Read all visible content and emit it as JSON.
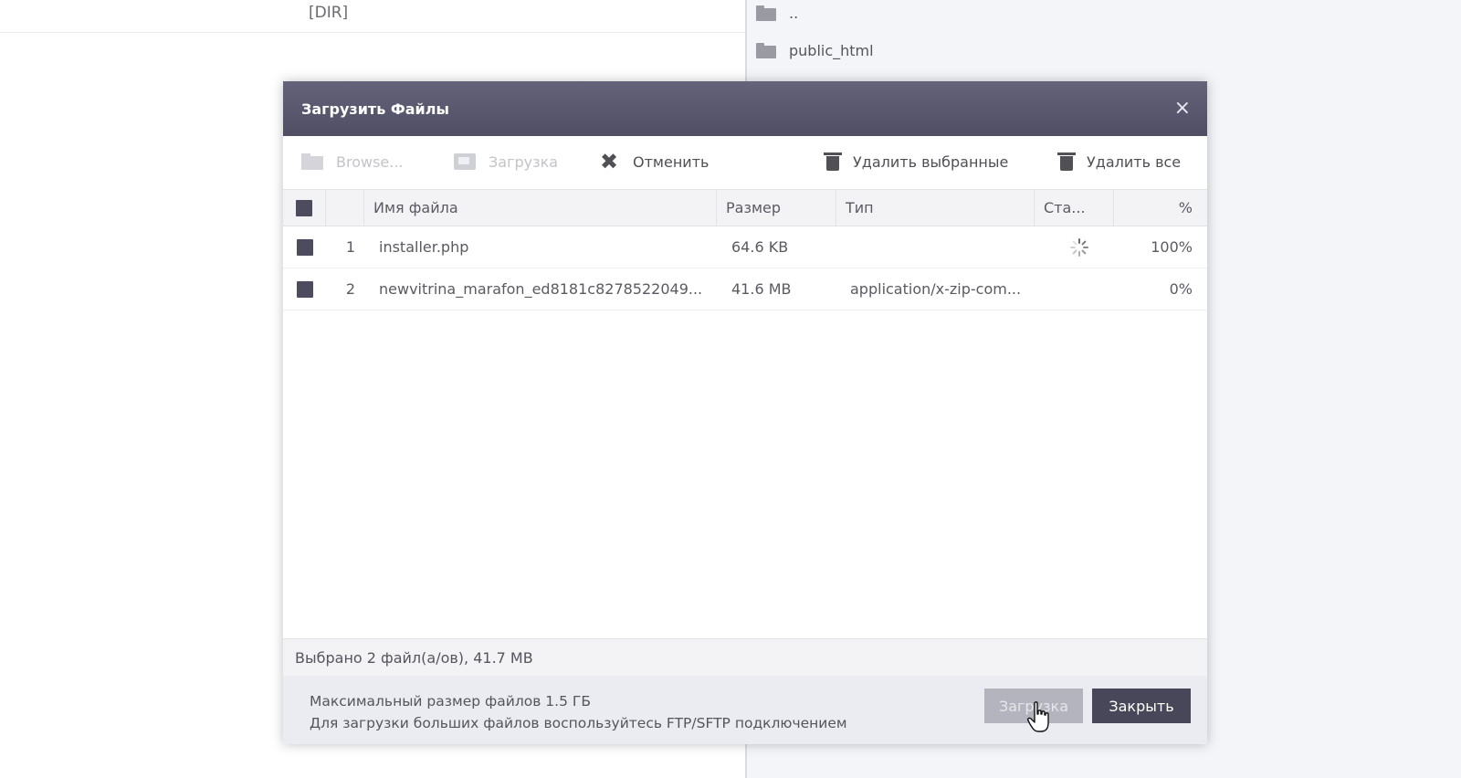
{
  "background": {
    "left_row_label": "[DIR]",
    "right_items": [
      {
        "name": "..",
        "icon": "folder-icon"
      },
      {
        "name": "public_html",
        "icon": "folder-icon"
      }
    ]
  },
  "dialog": {
    "title": "Загрузить Файлы",
    "close_glyph": "×",
    "toolbar": {
      "browse": "Browse...",
      "upload": "Загрузка",
      "cancel": "Отменить",
      "delete_selected": "Удалить выбранные",
      "delete_all": "Удалить все"
    },
    "columns": {
      "name": "Имя файла",
      "size": "Размер",
      "type": "Тип",
      "status": "Ста...",
      "percent": "%"
    },
    "rows": [
      {
        "num": "1",
        "name": "installer.php",
        "size": "64.6 KB",
        "type": "",
        "status": "loading",
        "percent": "100%"
      },
      {
        "num": "2",
        "name": "newvitrina_marafon_ed8181c8278522049...",
        "size": "41.6 MB",
        "type": "application/x-zip-com...",
        "status": "",
        "percent": "0%"
      }
    ],
    "summary": "Выбрано 2 файл(а/ов), 41.7 MB",
    "note_line1": "Максимальный размер файлов 1.5 ГБ",
    "note_line2": "Для загрузки больших файлов воспользуйтесь FTP/SFTP подключением",
    "buttons": {
      "upload": "Загрузка",
      "close": "Закрыть"
    }
  },
  "colors": {
    "header_bg": "#56556b",
    "dark_button": "#48475a",
    "checkbox": "#4d4c5e"
  }
}
